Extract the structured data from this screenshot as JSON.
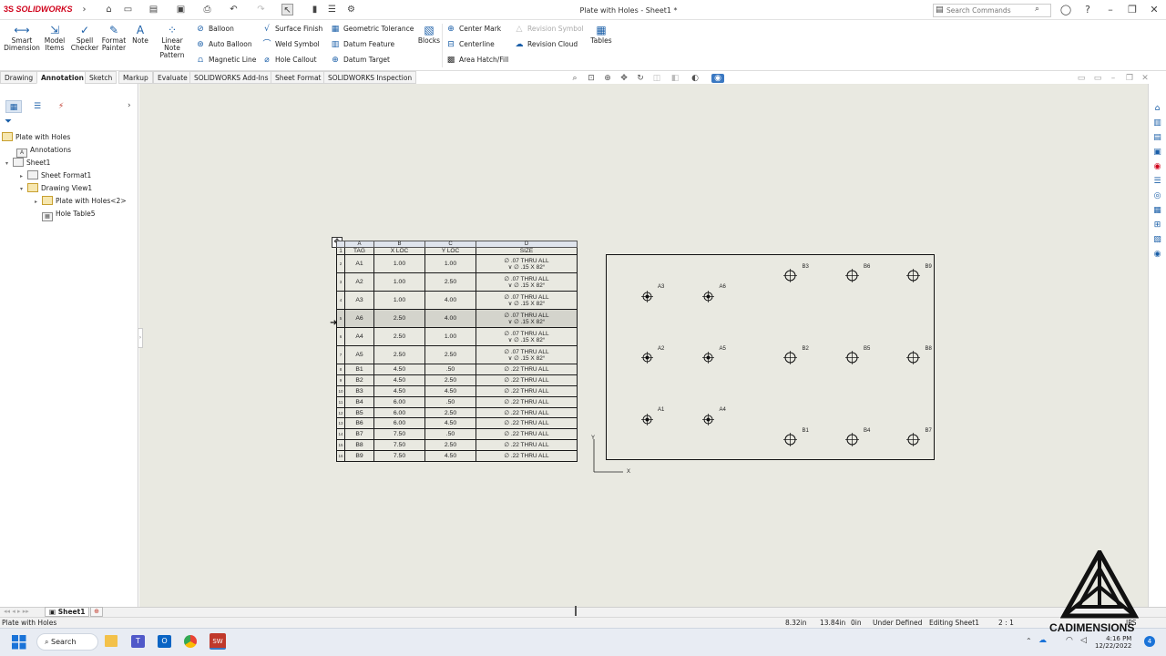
{
  "app": {
    "brand_ds": "3S",
    "brand_name": "SOLIDWORKS"
  },
  "title": "Plate with Holes - Sheet1 *",
  "search": {
    "placeholder": "Search Commands"
  },
  "ribbon": {
    "big_buttons": [
      {
        "label": "Smart Dimension",
        "icon": "smart-dimension-icon"
      },
      {
        "label": "Model Items",
        "icon": "model-items-icon"
      },
      {
        "label": "Spell Checker",
        "icon": "spell-checker-icon"
      },
      {
        "label": "Format Painter",
        "icon": "format-painter-icon"
      },
      {
        "label": "Note",
        "icon": "note-icon"
      },
      {
        "label": "Linear Note Pattern",
        "icon": "linear-note-pattern-icon"
      }
    ],
    "col1": [
      "Balloon",
      "Auto Balloon",
      "Magnetic Line"
    ],
    "col2": [
      "Surface Finish",
      "Weld Symbol",
      "Hole Callout"
    ],
    "col3": [
      "Geometric Tolerance",
      "Datum Feature",
      "Datum Target"
    ],
    "blocks": "Blocks",
    "col4": [
      "Center Mark",
      "Centerline",
      "Area Hatch/Fill"
    ],
    "col5": [
      "Revision Symbol",
      "Revision Cloud"
    ],
    "tables": "Tables"
  },
  "tabs": [
    "Drawing",
    "Annotation",
    "Sketch",
    "Markup",
    "Evaluate",
    "SOLIDWORKS Add-Ins",
    "Sheet Format",
    "SOLIDWORKS Inspection"
  ],
  "active_tab": "Annotation",
  "tree": {
    "root": "Plate with Holes",
    "annotations": "Annotations",
    "sheet": "Sheet1",
    "sheet_format": "Sheet Format1",
    "drawing_view": "Drawing View1",
    "part": "Plate with Holes<2>",
    "hole_table": "Hole Table5"
  },
  "hole_table": {
    "col_letters": [
      "A",
      "B",
      "C",
      "D"
    ],
    "headers": [
      "TAG",
      "X LOC",
      "Y LOC",
      "SIZE"
    ],
    "row_numbers": [
      "1",
      "2",
      "3",
      "4",
      "5",
      "6",
      "7",
      "8",
      "9",
      "10",
      "11",
      "12",
      "13",
      "14",
      "15",
      "16"
    ],
    "rows": [
      {
        "tag": "A1",
        "x": "1.00",
        "y": "1.00",
        "size1": "∅ .07 THRU ALL",
        "size2": "∨ ∅ .15 X 82°"
      },
      {
        "tag": "A2",
        "x": "1.00",
        "y": "2.50",
        "size1": "∅ .07 THRU ALL",
        "size2": "∨ ∅ .15 X 82°"
      },
      {
        "tag": "A3",
        "x": "1.00",
        "y": "4.00",
        "size1": "∅ .07 THRU ALL",
        "size2": "∨ ∅ .15 X 82°"
      },
      {
        "tag": "A6",
        "x": "2.50",
        "y": "4.00",
        "size1": "∅ .07 THRU ALL",
        "size2": "∨ ∅ .15 X 82°"
      },
      {
        "tag": "A4",
        "x": "2.50",
        "y": "1.00",
        "size1": "∅ .07 THRU ALL",
        "size2": "∨ ∅ .15 X 82°"
      },
      {
        "tag": "A5",
        "x": "2.50",
        "y": "2.50",
        "size1": "∅ .07 THRU ALL",
        "size2": "∨ ∅ .15 X 82°"
      },
      {
        "tag": "B1",
        "x": "4.50",
        "y": ".50",
        "size1": "∅ .22 THRU ALL",
        "size2": ""
      },
      {
        "tag": "B2",
        "x": "4.50",
        "y": "2.50",
        "size1": "∅ .22 THRU ALL",
        "size2": ""
      },
      {
        "tag": "B3",
        "x": "4.50",
        "y": "4.50",
        "size1": "∅ .22 THRU ALL",
        "size2": ""
      },
      {
        "tag": "B4",
        "x": "6.00",
        "y": ".50",
        "size1": "∅ .22 THRU ALL",
        "size2": ""
      },
      {
        "tag": "B5",
        "x": "6.00",
        "y": "2.50",
        "size1": "∅ .22 THRU ALL",
        "size2": ""
      },
      {
        "tag": "B6",
        "x": "6.00",
        "y": "4.50",
        "size1": "∅ .22 THRU ALL",
        "size2": ""
      },
      {
        "tag": "B7",
        "x": "7.50",
        "y": ".50",
        "size1": "∅ .22 THRU ALL",
        "size2": ""
      },
      {
        "tag": "B8",
        "x": "7.50",
        "y": "2.50",
        "size1": "∅ .22 THRU ALL",
        "size2": ""
      },
      {
        "tag": "B9",
        "x": "7.50",
        "y": "4.50",
        "size1": "∅ .22 THRU ALL",
        "size2": ""
      }
    ]
  },
  "drawing": {
    "labels": {
      "A1": "A1",
      "A2": "A2",
      "A3": "A3",
      "A4": "A4",
      "A5": "A5",
      "A6": "A6",
      "B1": "B1",
      "B2": "B2",
      "B3": "B3",
      "B4": "B4",
      "B5": "B5",
      "B6": "B6",
      "B7": "B7",
      "B8": "B8",
      "B9": "B9"
    },
    "axis_x": "X",
    "axis_y": "Y"
  },
  "sheet_tab": "Sheet1",
  "status": {
    "left": "Plate with Holes",
    "x": "8.32in",
    "y": "13.84in",
    "z": "0in",
    "state": "Under Defined",
    "editing": "Editing Sheet1",
    "scale": "2 : 1",
    "units": "IPS"
  },
  "taskbar": {
    "search": "Search",
    "time": "4:16 PM",
    "date": "12/22/2022"
  },
  "watermark": "CADIMENSIONS"
}
